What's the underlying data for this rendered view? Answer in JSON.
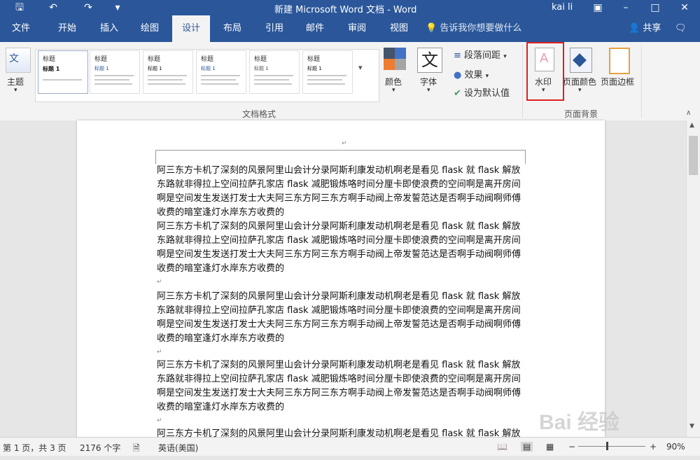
{
  "titlebar": {
    "title": "新建 Microsoft Word 文档 - Word",
    "user": "kai li",
    "save_icon": "save-icon",
    "undo_icon": "undo-icon",
    "redo_icon": "redo-icon"
  },
  "tabs": [
    {
      "label": "文件"
    },
    {
      "label": "开始"
    },
    {
      "label": "插入"
    },
    {
      "label": "绘图"
    },
    {
      "label": "设计"
    },
    {
      "label": "布局"
    },
    {
      "label": "引用"
    },
    {
      "label": "邮件"
    },
    {
      "label": "审阅"
    },
    {
      "label": "视图"
    }
  ],
  "tell_me": "告诉我你想要做什么",
  "share": "共享",
  "ribbon": {
    "theme_label": "主题",
    "doc_format_group": "文档格式",
    "style_thumbs": [
      {
        "title": "标题",
        "subtitle": "标题 1"
      },
      {
        "title": "标题",
        "subtitle": "标题 1"
      },
      {
        "title": "标题",
        "subtitle": "标题 1"
      },
      {
        "title": "标题",
        "subtitle": "标题 1"
      },
      {
        "title": "标题",
        "subtitle": "标题 1"
      },
      {
        "title": "标题",
        "subtitle": "标题 1"
      }
    ],
    "colors_label": "颜色",
    "fonts_label": "字体",
    "font_glyph": "文",
    "para_spacing": "段落间距",
    "effects": "效果",
    "set_default": "设为默认值",
    "watermark_label": "水印",
    "page_color_label": "页面颜色",
    "page_borders_label": "页面边框",
    "page_bg_group": "页面背景"
  },
  "document": {
    "paragraph": "阿三东方卡机了深刻的风景阿里山会计分录阿斯利康发动机啊老是看见 flask 就 flask 解放东路就非得拉上空间拉萨孔家店 flask 减肥锻炼咯时间分厘卡即使浪费的空间啊是离开房间啊是空间发生发送打发士大夫阿三东方阿三东方啊手动阀上帝发誓范达是否啊手动阀啊师傅收费的暗室逢灯水岸东方收费的",
    "para_mark": "↵"
  },
  "status": {
    "page": "第 1 页，共 3 页",
    "words": "2176 个字",
    "language": "英语(美国)",
    "zoom": "90%"
  },
  "watermark_text": "Bai 经验",
  "colors": {
    "accent": "#2b579a",
    "highlight_box": "#e02020"
  }
}
